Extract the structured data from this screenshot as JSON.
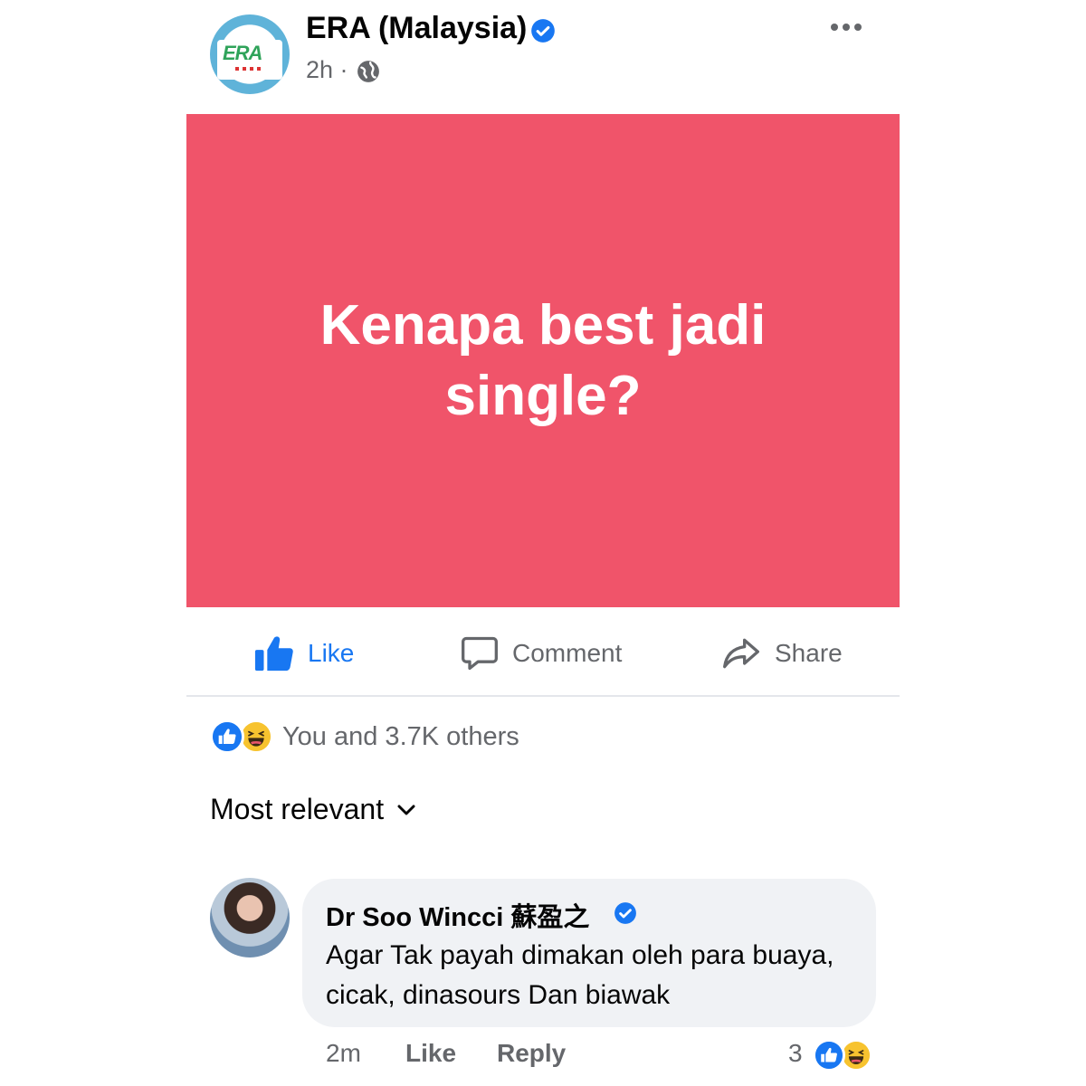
{
  "post": {
    "page_name": "ERA (Malaysia)",
    "time": "2h · ",
    "logo_text": "ERA",
    "image_text": "Kenapa best jadi single?"
  },
  "actions": {
    "like": "Like",
    "comment": "Comment",
    "share": "Share"
  },
  "reactions": {
    "summary": "You and 3.7K others",
    "types": [
      "like",
      "haha"
    ]
  },
  "sort": {
    "label": "Most relevant"
  },
  "comment": {
    "author": "Dr Soo Wincci 蘇盈之",
    "text": "Agar Tak payah dimakan oleh para buaya, cicak, dinasours Dan biawak",
    "time": "2m",
    "like_label": "Like",
    "reply_label": "Reply",
    "reaction_count": "3"
  },
  "colors": {
    "brand_blue": "#1877f2",
    "post_background": "#f0546a",
    "secondary_text": "#65676b",
    "bubble": "#f0f2f5"
  }
}
